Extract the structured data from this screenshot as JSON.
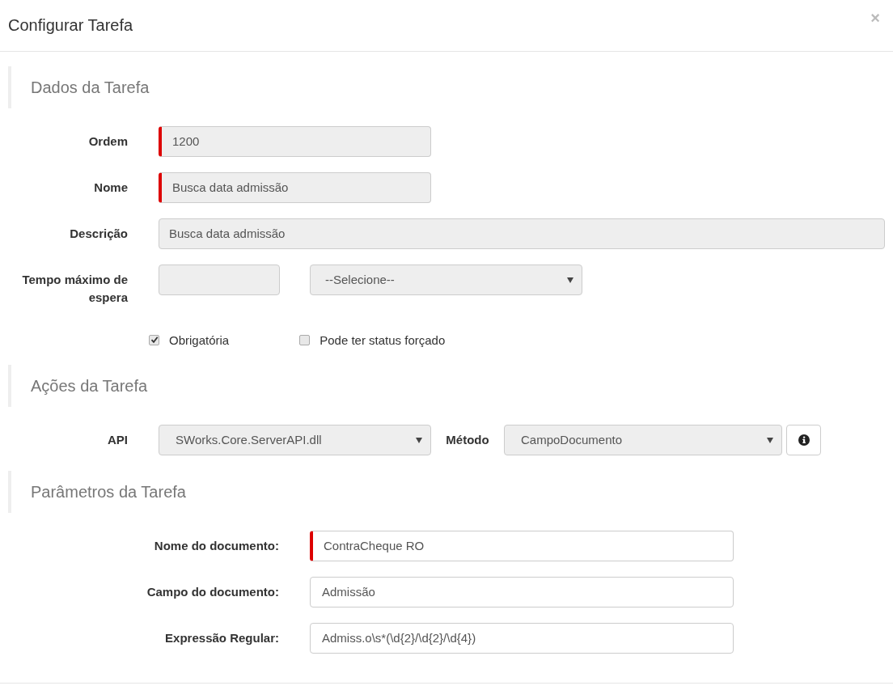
{
  "dialog": {
    "title": "Configurar Tarefa",
    "close": "×"
  },
  "dados": {
    "title": "Dados da Tarefa",
    "fields": [
      {
        "label": "Ordem",
        "value": "1200",
        "required": true,
        "disabled": true
      },
      {
        "label": "Nome",
        "value": "Busca data admissão",
        "required": true,
        "disabled": true
      },
      {
        "label": "Descrição",
        "value": "Busca data admissão",
        "required": false,
        "disabled": true
      }
    ],
    "tempo": {
      "label": "Tempo máximo de espera",
      "disabled": true,
      "unit": {
        "value": "--Selecione--",
        "disabled": true
      }
    },
    "checks": [
      {
        "label": "Obrigatória",
        "checked": true
      },
      {
        "label": "Pode ter status forçado",
        "checked": false
      }
    ]
  },
  "acoes": {
    "title": "Ações da Tarefa",
    "api": {
      "label": "API",
      "value": "SWorks.Core.ServerAPI.dll",
      "disabled": true
    },
    "metodo": {
      "label": "Método",
      "value": "CampoDocumento",
      "disabled": true
    }
  },
  "parametros": {
    "title": "Parâmetros da Tarefa",
    "fields": [
      {
        "label": "Nome do documento:",
        "value": "ContraCheque RO",
        "required": true,
        "disabled": false
      },
      {
        "label": "Campo do documento:",
        "value": "Admissão",
        "required": false,
        "disabled": false
      },
      {
        "label": "Expressão Regular:",
        "value": "Admiss.o\\s*(\\d{2}/\\d{2}/\\d{4})",
        "required": false,
        "disabled": false
      }
    ]
  }
}
